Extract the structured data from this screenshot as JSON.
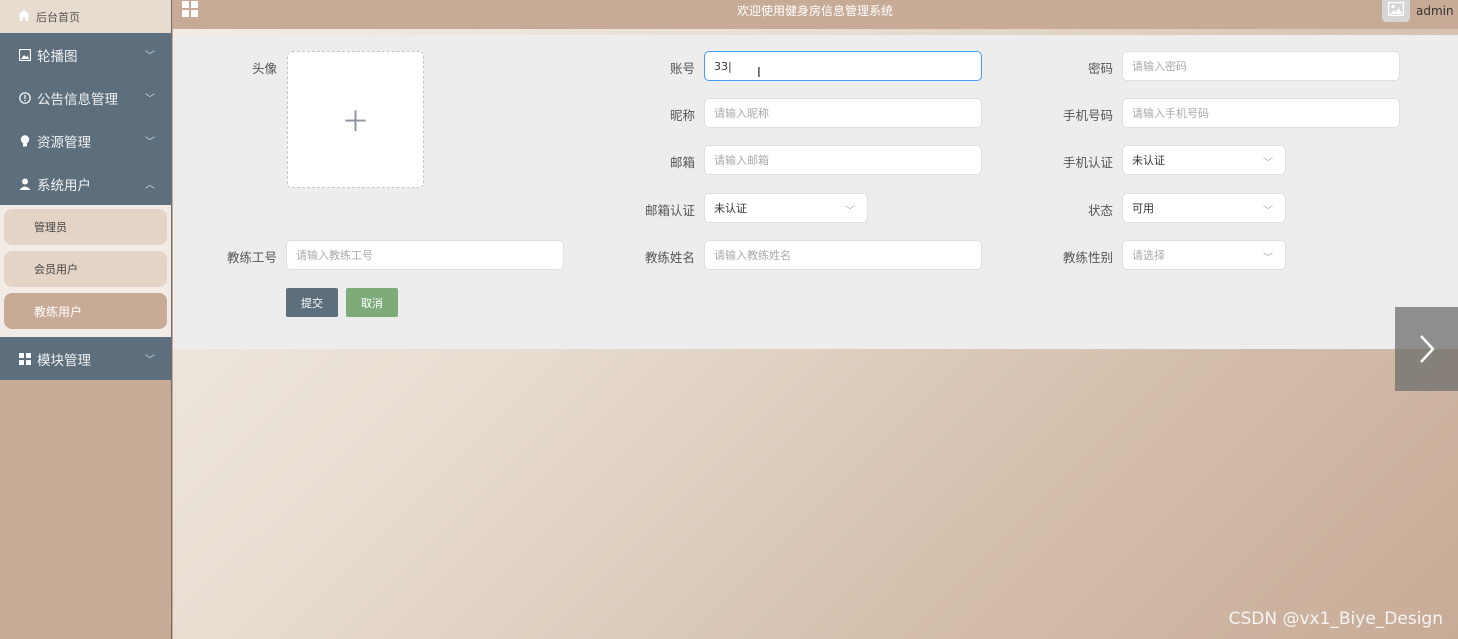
{
  "sidebar": {
    "home_label": "后台首页",
    "items": [
      {
        "label": "轮播图"
      },
      {
        "label": "公告信息管理"
      },
      {
        "label": "资源管理"
      },
      {
        "label": "系统用户"
      }
    ],
    "submenu": [
      {
        "label": "管理员"
      },
      {
        "label": "会员用户"
      },
      {
        "label": "教练用户"
      }
    ],
    "module_label": "模块管理"
  },
  "topbar": {
    "title": "欢迎使用健身房信息管理系统",
    "username": "admin"
  },
  "form": {
    "avatar_label": "头像",
    "account_label": "账号",
    "account_value": "33",
    "password_label": "密码",
    "password_placeholder": "请输入密码",
    "nickname_label": "昵称",
    "nickname_placeholder": "请输入昵称",
    "phone_label": "手机号码",
    "phone_placeholder": "请输入手机号码",
    "email_label": "邮箱",
    "email_placeholder": "请输入邮箱",
    "phone_verify_label": "手机认证",
    "phone_verify_value": "未认证",
    "email_verify_label": "邮箱认证",
    "email_verify_value": "未认证",
    "status_label": "状态",
    "status_value": "可用",
    "coach_id_label": "教练工号",
    "coach_id_placeholder": "请输入教练工号",
    "coach_name_label": "教练姓名",
    "coach_name_placeholder": "请输入教练姓名",
    "coach_gender_label": "教练性别",
    "coach_gender_placeholder": "请选择",
    "submit_label": "提交",
    "cancel_label": "取消"
  },
  "watermark": "CSDN @vx1_Biye_Design"
}
